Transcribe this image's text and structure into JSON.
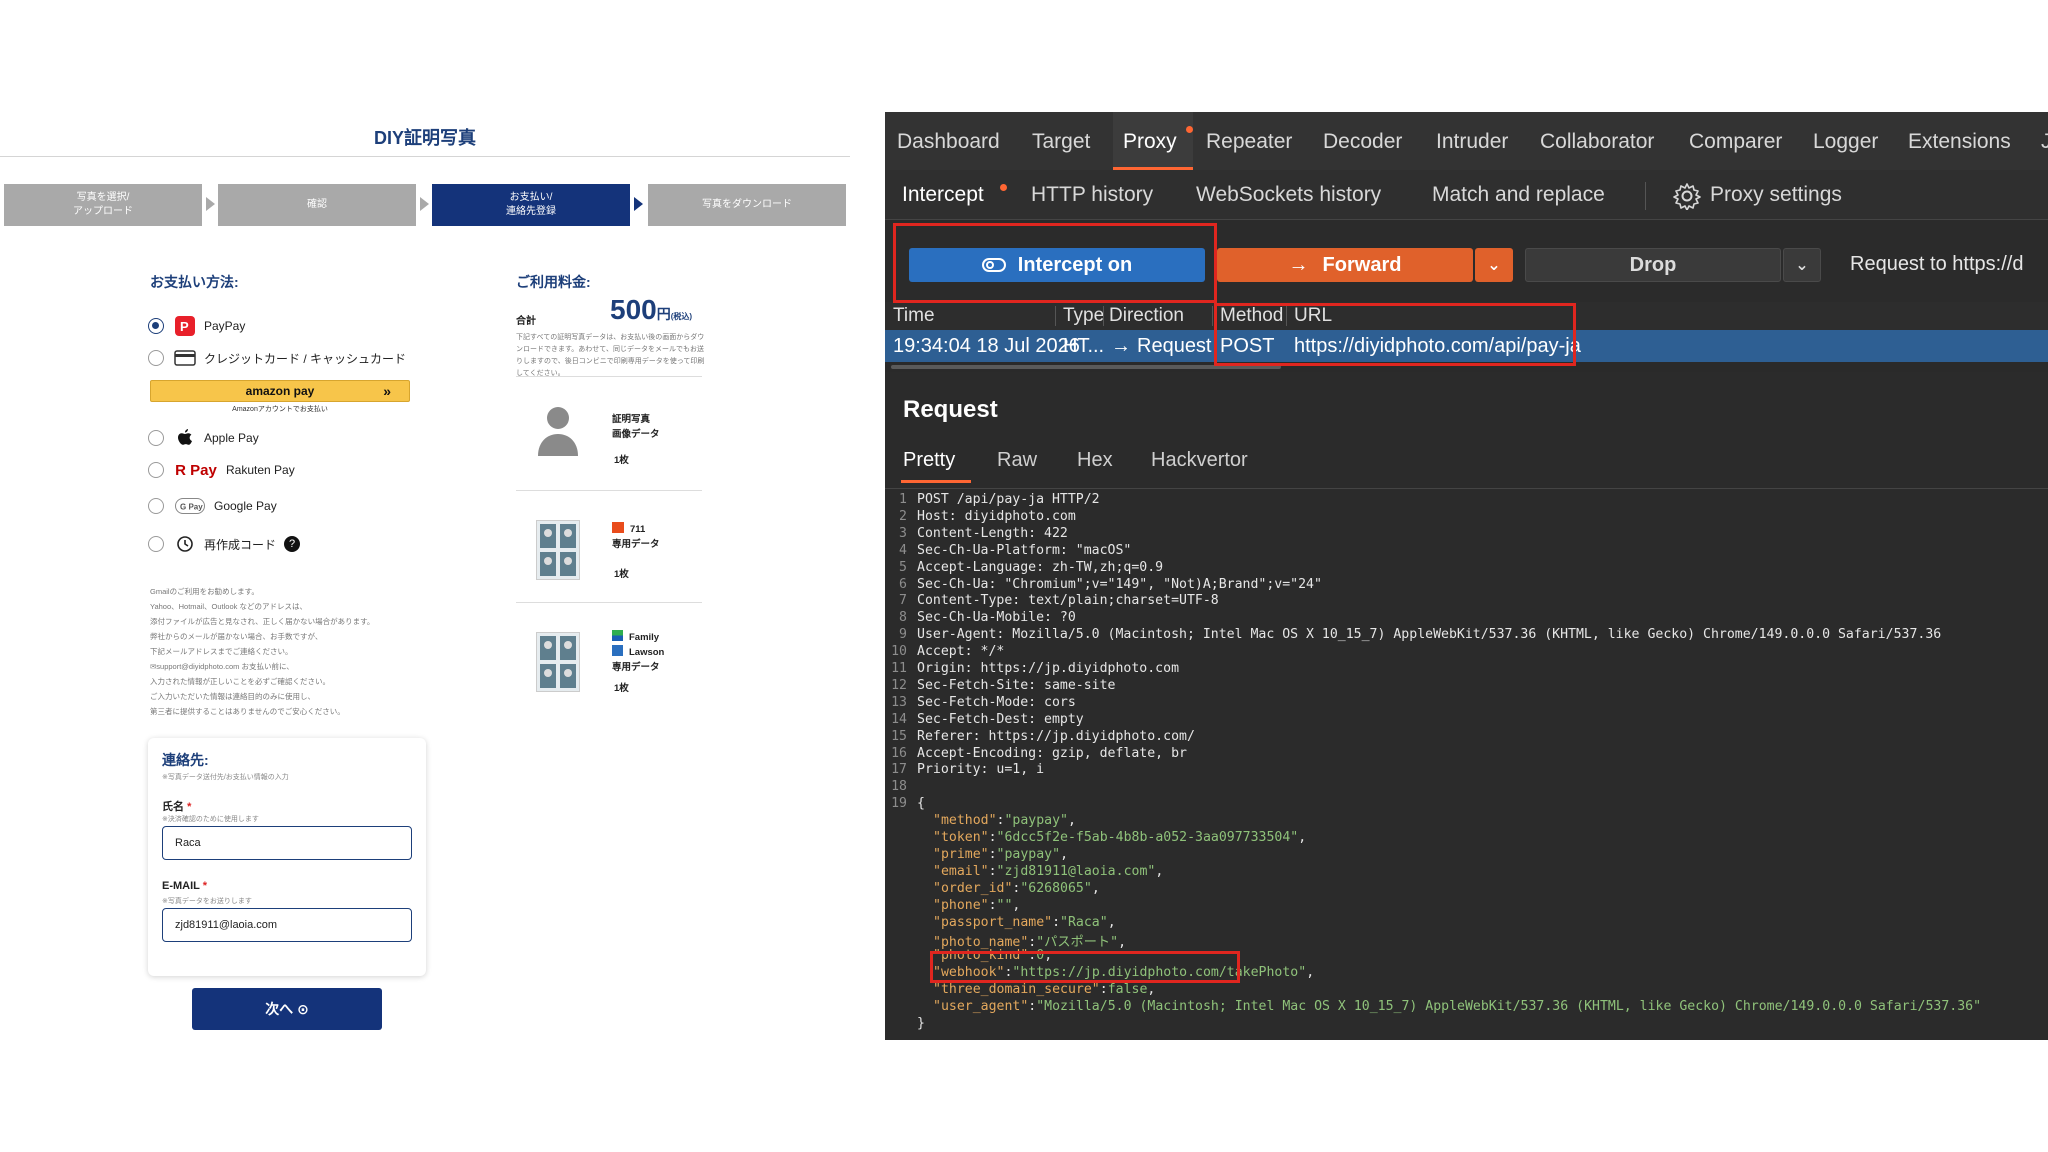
{
  "checkout": {
    "site_title": "DIY証明写真",
    "steps": [
      "写真を選択/\nアップロード",
      "確認",
      "お支払い/\n連絡先登録",
      "写真をダウンロード"
    ],
    "payment_heading": "お支払い方法:",
    "payment_options": [
      {
        "label": "PayPay",
        "icon": "paypay-icon",
        "selected": true
      },
      {
        "label": "クレジットカード / キャッシュカード",
        "icon": "credit-card-icon",
        "selected": false
      },
      {
        "label": "Apple Pay",
        "icon": "apple-icon",
        "selected": false
      },
      {
        "label": "Rakuten Pay",
        "icon": "rakuten-pay-icon",
        "selected": false
      },
      {
        "label": "Google Pay",
        "icon": "google-pay-icon",
        "selected": false
      },
      {
        "label": "再作成コード",
        "icon": "recreate-code-icon",
        "selected": false
      }
    ],
    "amazon_pay_label": "amazon pay",
    "amazon_pay_sub": "Amazonアカウントでお支払い",
    "notes": [
      "Gmailのご利用をお勧めします。",
      "Yahoo、Hotmail、Outlook などのアドレスは、",
      "添付ファイルが広告と見なされ、正しく届かない場合があります。",
      "弊社からのメールが届かない場合、お手数ですが、",
      "下記メールアドレスまでご連絡ください。",
      "✉support@diyidphoto.com お支払い前に、",
      "入力された情報が正しいことを必ずご確認ください。",
      "ご入力いただいた情報は連絡目的のみに使用し、",
      "第三者に提供することはありませんのでご安心ください。"
    ],
    "summary_heading": "ご利用料金:",
    "total_label": "合計",
    "price_value": "500",
    "price_unit": "円",
    "price_tax": "(税込)",
    "summary_note": "下記すべての証明写真データは、お支払い後の画面からダウンロードできます。あわせて、同じデータをメールでもお送りしますので、後日コンビニで印刷専用データを使って印刷してください。",
    "products": [
      {
        "lines": [
          "証明写真",
          "画像データ"
        ],
        "qty": "1枚"
      },
      {
        "lines": [
          "711",
          "専用データ"
        ],
        "qty": "1枚"
      },
      {
        "lines": [
          "Family",
          "Lawson",
          "専用データ"
        ],
        "qty": "1枚"
      }
    ],
    "contact": {
      "heading": "連絡先:",
      "sub": "※写真データ送付先/お支払い情報の入力",
      "name_label": "氏名",
      "name_required": "*",
      "name_sub": "※決済確認のために使用します",
      "name_value": "Raca",
      "email_label": "E-MAIL",
      "email_required": "*",
      "email_sub": "※写真データをお送りします",
      "email_value": "zjd81911@laoia.com"
    },
    "next_button": "次へ ⊙"
  },
  "burp": {
    "top_tabs": [
      "Dashboard",
      "Target",
      "Proxy",
      "Repeater",
      "Decoder",
      "Intruder",
      "Collaborator",
      "Comparer",
      "Logger",
      "Extensions",
      "J"
    ],
    "active_top_tab": "Proxy",
    "sub_tabs": [
      "Intercept",
      "HTTP history",
      "WebSockets history",
      "Match and replace"
    ],
    "proxy_settings": "Proxy settings",
    "intercept_button": "Intercept on",
    "forward_button": "Forward",
    "drop_button": "Drop",
    "request_to": "Request to https://d",
    "table_headers": [
      "Time",
      "Type",
      "Direction",
      "Method",
      "URL"
    ],
    "row": {
      "time": "19:34:04 18 Jul 2026",
      "type": "HT...",
      "direction": "Request",
      "method": "POST",
      "url": "https://diyidphoto.com/api/pay-ja"
    },
    "request_title": "Request",
    "request_tabs": [
      "Pretty",
      "Raw",
      "Hex",
      "Hackvertor"
    ],
    "http_lines": [
      "POST /api/pay-ja HTTP/2",
      "Host: diyidphoto.com",
      "Content-Length: 422",
      "Sec-Ch-Ua-Platform: \"macOS\"",
      "Accept-Language: zh-TW,zh;q=0.9",
      "Sec-Ch-Ua: \"Chromium\";v=\"149\", \"Not)A;Brand\";v=\"24\"",
      "Content-Type: text/plain;charset=UTF-8",
      "Sec-Ch-Ua-Mobile: ?0",
      "User-Agent: Mozilla/5.0 (Macintosh; Intel Mac OS X 10_15_7) AppleWebKit/537.36 (KHTML, like Gecko) Chrome/149.0.0.0 Safari/537.36",
      "Accept: */*",
      "Origin: https://jp.diyidphoto.com",
      "Sec-Fetch-Site: same-site",
      "Sec-Fetch-Mode: cors",
      "Sec-Fetch-Dest: empty",
      "Referer: https://jp.diyidphoto.com/",
      "Accept-Encoding: gzip, deflate, br",
      "Priority: u=1, i",
      "",
      "{"
    ],
    "json_body": [
      {
        "k": "\"method\"",
        "v": "\"paypay\"",
        "t": ","
      },
      {
        "k": "\"token\"",
        "v": "\"6dcc5f2e-f5ab-4b8b-a052-3aa097733504\"",
        "t": ","
      },
      {
        "k": "\"prime\"",
        "v": "\"paypay\"",
        "t": ","
      },
      {
        "k": "\"email\"",
        "v": "\"zjd81911@laoia.com\"",
        "t": ","
      },
      {
        "k": "\"order_id\"",
        "v": "\"6268065\"",
        "t": ","
      },
      {
        "k": "\"phone\"",
        "v": "\"\"",
        "t": ","
      },
      {
        "k": "\"passport_name\"",
        "v": "\"Raca\"",
        "t": ","
      },
      {
        "k": "\"photo_name\"",
        "v": "\"パスポート\"",
        "t": ","
      },
      {
        "k": "\"photo_kind\"",
        "v": "0",
        "t": ","
      },
      {
        "k": "\"webhook\"",
        "v": "\"https://jp.diyidphoto.com/takePhoto\"",
        "t": ","
      },
      {
        "k": "\"three_domain_secure\"",
        "v": "false",
        "t": ","
      },
      {
        "k": "\"user_agent\"",
        "v": "\"Mozilla/5.0 (Macintosh; Intel Mac OS X 10_15_7) AppleWebKit/537.36 (KHTML, like Gecko) Chrome/149.0.0.0 Safari/537.36\"",
        "t": ""
      }
    ],
    "closing_brace": "}",
    "colors": {
      "accent": "#ff6633",
      "intercept": "#2a6fbf",
      "forward": "#e0612b",
      "selected_row": "#2e5f93",
      "highlight": "#e0261f"
    }
  }
}
